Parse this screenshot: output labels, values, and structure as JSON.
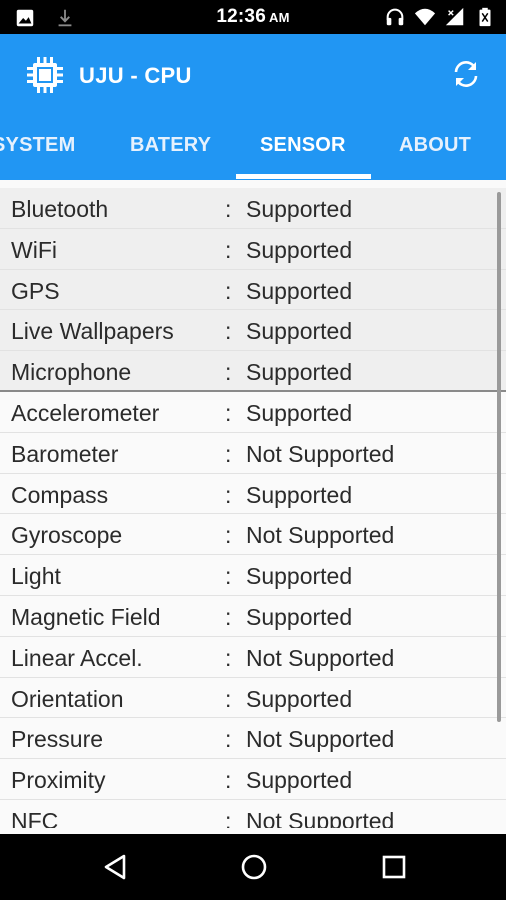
{
  "status_bar": {
    "time": "12:36",
    "ampm": "AM",
    "left_icons": [
      "image-icon",
      "download-icon"
    ],
    "right_icons": [
      "headphones-icon",
      "wifi-icon",
      "signal-icon",
      "battery-icon"
    ]
  },
  "app_bar": {
    "title": "UJU - CPU",
    "logo_icon": "cpu-chip-icon",
    "action_icon": "refresh-icon"
  },
  "tabs": [
    {
      "label": "SYSTEM",
      "selected": false
    },
    {
      "label": "BATERY",
      "selected": false
    },
    {
      "label": "SENSOR",
      "selected": true
    },
    {
      "label": "ABOUT",
      "selected": false
    }
  ],
  "sensors": [
    {
      "name": "Bluetooth",
      "sep": ":",
      "value": "Supported"
    },
    {
      "name": "WiFi",
      "sep": ":",
      "value": "Supported"
    },
    {
      "name": "GPS",
      "sep": ":",
      "value": "Supported"
    },
    {
      "name": "Live Wallpapers",
      "sep": ":",
      "value": "Supported"
    },
    {
      "name": "Microphone",
      "sep": ":",
      "value": "Supported"
    },
    {
      "name": "Accelerometer",
      "sep": ":",
      "value": "Supported"
    },
    {
      "name": "Barometer",
      "sep": ":",
      "value": "Not Supported"
    },
    {
      "name": "Compass",
      "sep": ":",
      "value": "Supported"
    },
    {
      "name": "Gyroscope",
      "sep": ":",
      "value": "Not Supported"
    },
    {
      "name": "Light",
      "sep": ":",
      "value": "Supported"
    },
    {
      "name": "Magnetic Field",
      "sep": ":",
      "value": "Supported"
    },
    {
      "name": "Linear Accel.",
      "sep": ":",
      "value": "Not Supported"
    },
    {
      "name": "Orientation",
      "sep": ":",
      "value": "Supported"
    },
    {
      "name": "Pressure",
      "sep": ":",
      "value": "Not Supported"
    },
    {
      "name": "Proximity",
      "sep": ":",
      "value": "Supported"
    },
    {
      "name": "NFC",
      "sep": ":",
      "value": "Not Supported"
    }
  ],
  "nav_bar": {
    "icons": [
      "back-icon",
      "home-icon",
      "recents-icon"
    ]
  },
  "colors": {
    "primary": "#2196f3",
    "status_bar": "#000000",
    "list_background": "#fafafa",
    "text": "#2b2b2b"
  }
}
